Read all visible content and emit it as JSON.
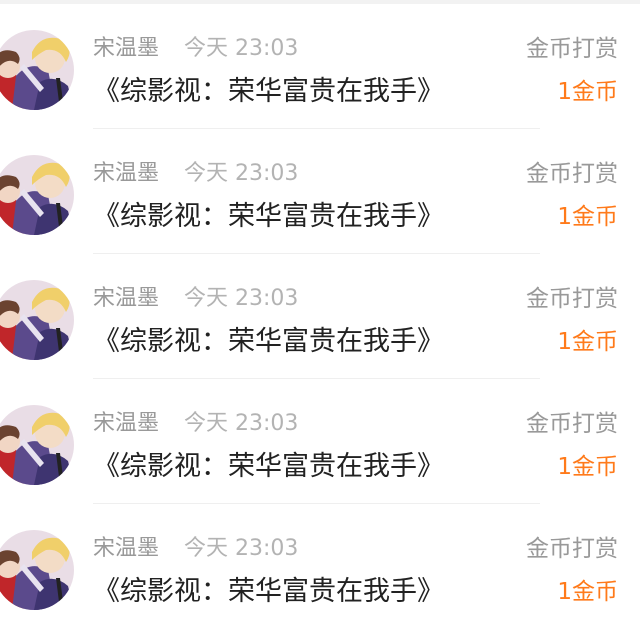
{
  "items": [
    {
      "user": "宋温墨",
      "time": "今天 23:03",
      "book": "《综影视：荣华富贵在我手》",
      "action": "金币打赏",
      "amount": "1金币",
      "avatar_icon": "anime-avatar-icon"
    },
    {
      "user": "宋温墨",
      "time": "今天 23:03",
      "book": "《综影视：荣华富贵在我手》",
      "action": "金币打赏",
      "amount": "1金币",
      "avatar_icon": "anime-avatar-icon"
    },
    {
      "user": "宋温墨",
      "time": "今天 23:03",
      "book": "《综影视：荣华富贵在我手》",
      "action": "金币打赏",
      "amount": "1金币",
      "avatar_icon": "anime-avatar-icon"
    },
    {
      "user": "宋温墨",
      "time": "今天 23:03",
      "book": "《综影视：荣华富贵在我手》",
      "action": "金币打赏",
      "amount": "1金币",
      "avatar_icon": "anime-avatar-icon"
    },
    {
      "user": "宋温墨",
      "time": "今天 23:03",
      "book": "《综影视：荣华富贵在我手》",
      "action": "金币打赏",
      "amount": "1金币",
      "avatar_icon": "anime-avatar-icon"
    }
  ],
  "colors": {
    "name": "#999999",
    "time": "#b3b3b3",
    "title": "#222222",
    "amount": "#ff7a1a",
    "divider": "#efefef"
  }
}
